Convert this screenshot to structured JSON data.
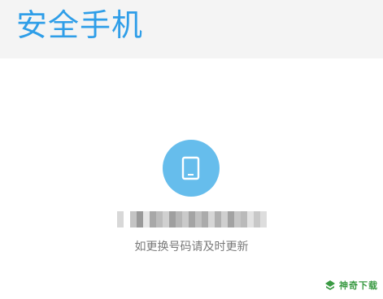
{
  "header": {
    "title": "安全手机"
  },
  "icons": {
    "phone": "phone-icon",
    "watermark_logo": "download-leaf-icon"
  },
  "colors": {
    "accent": "#2f9ee8",
    "badge": "#66bdec",
    "hint_text": "#7a7a7a",
    "watermark": "#3a9a43"
  },
  "phone": {
    "number_masked": true
  },
  "hint": "如更换号码请及时更新",
  "watermark": {
    "text": "神奇下载"
  }
}
